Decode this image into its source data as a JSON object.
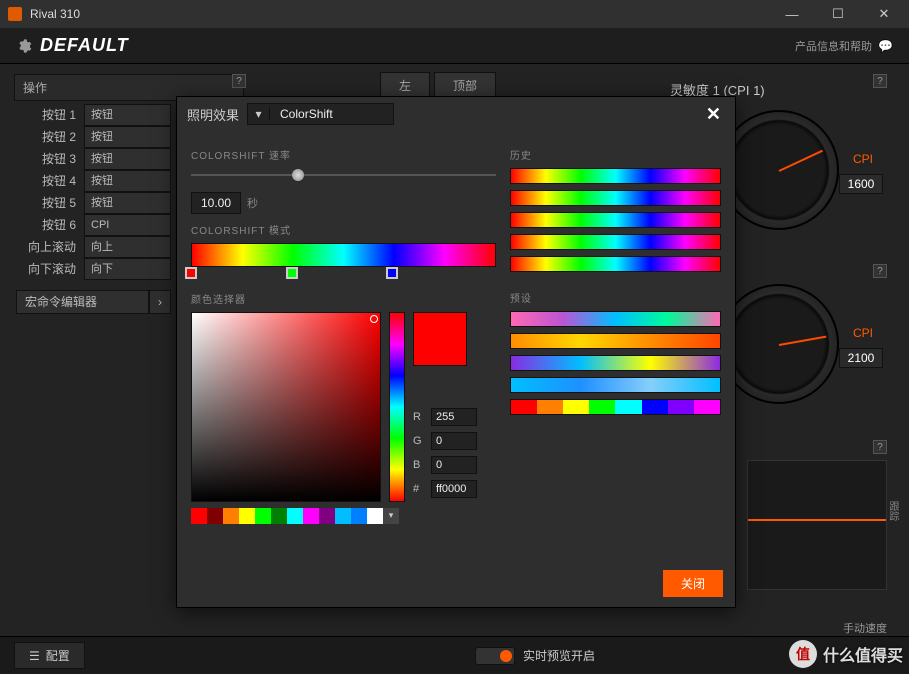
{
  "window": {
    "title": "Rival 310"
  },
  "header": {
    "profile": "DEFAULT",
    "help": "产品信息和帮助"
  },
  "panels": {
    "actions": "操作",
    "sensitivity": "灵敏度 1 (CPI 1)"
  },
  "tabs": {
    "left": "左",
    "top": "顶部"
  },
  "buttons": [
    {
      "label": "按钮 1",
      "assign": "按钮"
    },
    {
      "label": "按钮 2",
      "assign": "按钮"
    },
    {
      "label": "按钮 3",
      "assign": "按钮"
    },
    {
      "label": "按钮 4",
      "assign": "按钮"
    },
    {
      "label": "按钮 5",
      "assign": "按钮"
    },
    {
      "label": "按钮 6",
      "assign": "CPI"
    },
    {
      "label": "向上滚动",
      "assign": "向上"
    },
    {
      "label": "向下滚动",
      "assign": "向下"
    }
  ],
  "macro": {
    "label": "宏命令编辑器"
  },
  "gauges": {
    "cpi_label": "CPI",
    "cpi1": "1600",
    "cpi2": "2100"
  },
  "speed": {
    "label": "手动速度",
    "axis": "跟踪"
  },
  "modal": {
    "title": "照明效果",
    "effect": "ColorShift",
    "sections": {
      "rate": "COLORSHIFT 速率",
      "mode": "COLORSHIFT 模式",
      "picker": "颜色选择器",
      "history": "历史",
      "presets": "预设"
    },
    "rate": {
      "value": "10.00",
      "unit": "秒",
      "pos": 33
    },
    "stops": [
      {
        "color": "#ff0000",
        "pos": 0
      },
      {
        "color": "#00ff00",
        "pos": 33
      },
      {
        "color": "#0000ff",
        "pos": 66
      }
    ],
    "rgb": {
      "R": "255",
      "G": "0",
      "B": "0",
      "hex": "ff0000"
    },
    "preview": "#ff0000",
    "swatches": [
      "#ff0000",
      "#800000",
      "#ff8000",
      "#ffff00",
      "#00ff00",
      "#008000",
      "#00ffff",
      "#ff00ff",
      "#800080",
      "#00bfff",
      "#0080ff",
      "#ffffff"
    ],
    "history_items": [
      "linear-gradient(90deg,#f00,#ff0,#0f0,#0ff,#00f,#f0f,#f00)",
      "linear-gradient(90deg,#f00,#ff0,#0f0,#0ff,#00f,#f0f,#f00)",
      "linear-gradient(90deg,#f00,#ff0,#0f0,#0ff,#00f,#f0f,#f00)",
      "linear-gradient(90deg,#f00,#ff0,#0f0,#0ff,#00f,#f0f,#f00)",
      "linear-gradient(90deg,#f00,#ff0,#0f0,#0ff,#00f,#f0f,#f00)"
    ],
    "preset_items": [
      "linear-gradient(90deg,#ff69b4,#ba55d3,#00bfff,#00fa9a,#ff69b4)",
      "linear-gradient(90deg,#ff8c00,#ffd700,#ff8c00,#ff4500)",
      "linear-gradient(90deg,#8a2be2,#00bfff,#ffff00,#8a2be2)",
      "linear-gradient(90deg,#00bfff,#1e90ff,#87cefa,#00bfff)"
    ],
    "discrete_preset": [
      "#ff0000",
      "#ff8000",
      "#ffff00",
      "#00ff00",
      "#00ffff",
      "#0000ff",
      "#8000ff",
      "#ff00ff"
    ],
    "close": "关闭"
  },
  "bottom": {
    "config": "配置",
    "preview": "实时预览开启"
  },
  "watermark": {
    "badge": "值",
    "text": "什么值得买"
  }
}
